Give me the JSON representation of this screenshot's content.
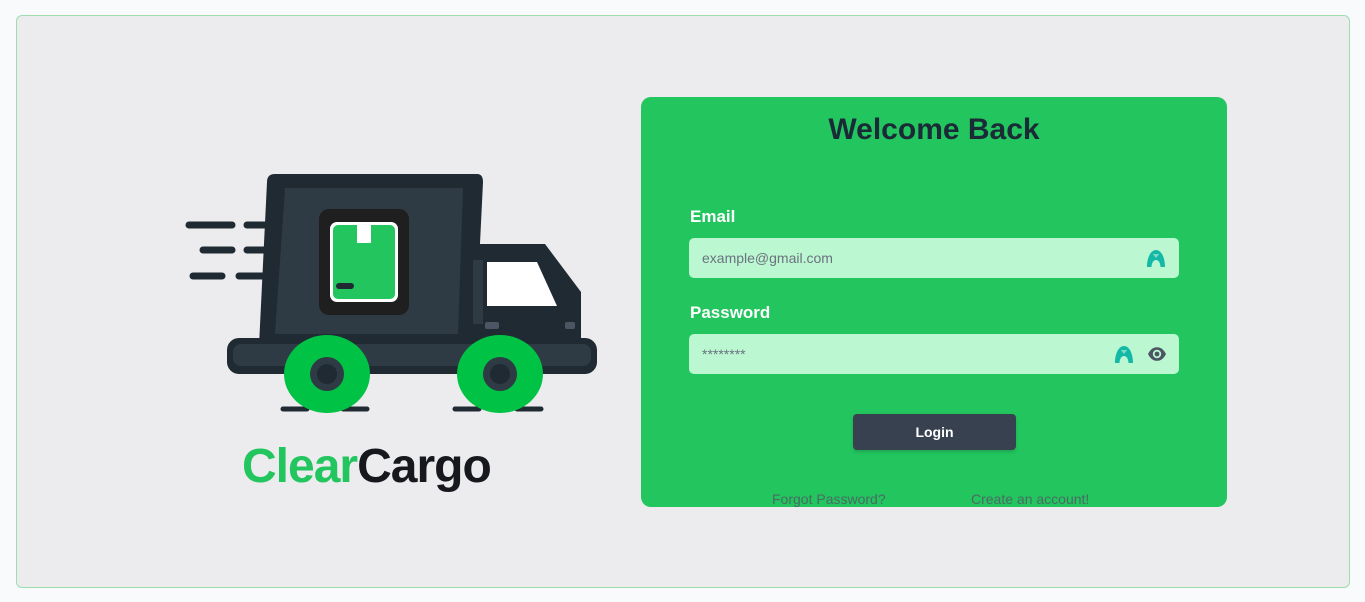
{
  "brand": {
    "name_part1": "Clear",
    "name_part2": "Cargo",
    "logo_icon": "delivery-truck-icon",
    "colors": {
      "green": "#22c55e",
      "dark": "#16181d",
      "truck_body": "#2e3b45"
    }
  },
  "login": {
    "title": "Welcome Back",
    "email": {
      "label": "Email",
      "placeholder": "example@gmail.com",
      "icon": "password-manager-icon"
    },
    "password": {
      "label": "Password",
      "placeholder": "********",
      "icons": [
        "password-manager-icon",
        "eye-icon"
      ]
    },
    "submit_label": "Login",
    "forgot_link": "Forgot Password?",
    "create_link": "Create an account!",
    "colors": {
      "card": "#22c55e",
      "input": "#bbf7d0",
      "button": "#384150",
      "title": "#1b2a37"
    }
  }
}
